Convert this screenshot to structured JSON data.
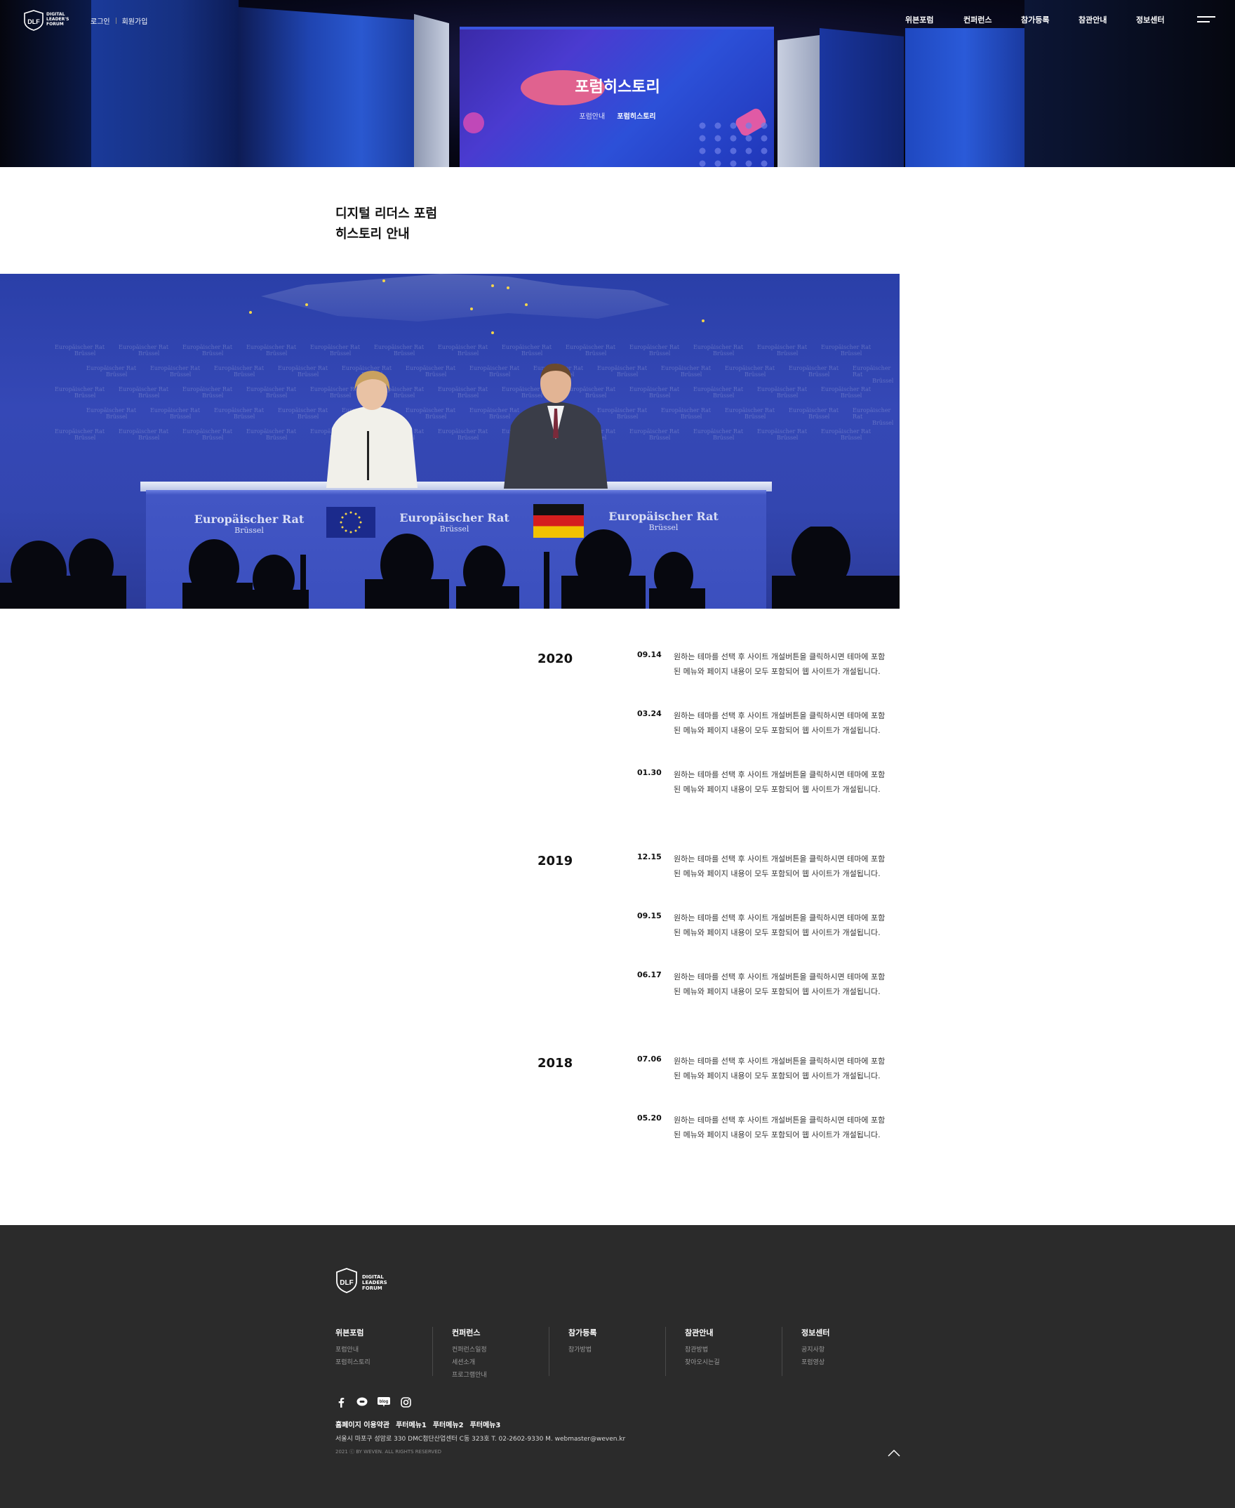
{
  "header": {
    "logo_lines": [
      "DIGITAL",
      "LEADER'S",
      "FORUM"
    ],
    "logo_mark": "DLF",
    "auth": {
      "login": "로그인",
      "signup": "회원가입"
    },
    "nav": [
      "위븐포럼",
      "컨퍼런스",
      "참가등록",
      "참관안내",
      "정보센터"
    ],
    "menu_icon": "hamburger-icon"
  },
  "hero": {
    "title": "포럼히스토리",
    "breadcrumb": [
      "포럼안내",
      "포럼히스토리"
    ]
  },
  "intro": {
    "line1": "디지털 리더스 포럼",
    "line2": "히스토리 안내"
  },
  "photo": {
    "wall_text": [
      "Europäischer Rat",
      "Brüssel"
    ],
    "podium_labels": [
      {
        "l1": "Europäischer Rat",
        "l2": "Brüssel"
      },
      {
        "l1": "Europäischer Rat",
        "l2": "Brüssel"
      },
      {
        "l1": "Europäischer Rat",
        "l2": "Brüssel"
      }
    ]
  },
  "timeline": [
    {
      "year": "2020",
      "entries": [
        {
          "date": "09.14",
          "text": "원하는 테마를 선택 후 사이트 개설버튼을 클릭하시면 테마에 포함된 메뉴와 페이지 내용이 모두 포함되어 웹 사이트가 개설됩니다."
        },
        {
          "date": "03.24",
          "text": "원하는 테마를 선택 후 사이트 개설버튼을 클릭하시면 테마에 포함된 메뉴와 페이지 내용이 모두 포함되어 웹 사이트가 개설됩니다."
        },
        {
          "date": "01.30",
          "text": "원하는 테마를 선택 후 사이트 개설버튼을 클릭하시면 테마에 포함된 메뉴와 페이지 내용이 모두 포함되어 웹 사이트가 개설됩니다."
        }
      ]
    },
    {
      "year": "2019",
      "entries": [
        {
          "date": "12.15",
          "text": "원하는 테마를 선택 후 사이트 개설버튼을 클릭하시면 테마에 포함된 메뉴와 페이지 내용이 모두 포함되어 웹 사이트가 개설됩니다."
        },
        {
          "date": "09.15",
          "text": "원하는 테마를 선택 후 사이트 개설버튼을 클릭하시면 테마에 포함된 메뉴와 페이지 내용이 모두 포함되어 웹 사이트가 개설됩니다."
        },
        {
          "date": "06.17",
          "text": "원하는 테마를 선택 후 사이트 개설버튼을 클릭하시면 테마에 포함된 메뉴와 페이지 내용이 모두 포함되어 웹 사이트가 개설됩니다."
        }
      ]
    },
    {
      "year": "2018",
      "entries": [
        {
          "date": "07.06",
          "text": "원하는 테마를 선택 후 사이트 개설버튼을 클릭하시면 테마에 포함된 메뉴와 페이지 내용이 모두 포함되어 웹 사이트가 개설됩니다."
        },
        {
          "date": "05.20",
          "text": "원하는 테마를 선택 후 사이트 개설버튼을 클릭하시면 테마에 포함된 메뉴와 페이지 내용이 모두 포함되어 웹 사이트가 개설됩니다."
        }
      ]
    }
  ],
  "footer": {
    "logo_lines": [
      "DIGITAL",
      "LEADERS",
      "FORUM"
    ],
    "logo_mark": "DLF",
    "columns": [
      {
        "heading": "위븐포럼",
        "items": [
          "포럼안내",
          "포럼히스토리"
        ]
      },
      {
        "heading": "컨퍼런스",
        "items": [
          "컨퍼런스일정",
          "세션소개",
          "프로그램안내"
        ]
      },
      {
        "heading": "참가등록",
        "items": [
          "참가방법"
        ]
      },
      {
        "heading": "참관안내",
        "items": [
          "참관방법",
          "찾아오시는길"
        ]
      },
      {
        "heading": "정보센터",
        "items": [
          "공지사항",
          "포럼영상"
        ]
      }
    ],
    "social": [
      "facebook-icon",
      "talk-icon",
      "blog-icon",
      "instagram-icon"
    ],
    "blog_label": "blog",
    "links": [
      "홈페이지 이용약관",
      "푸터메뉴1",
      "푸터메뉴2",
      "푸터메뉴3"
    ],
    "address": "서울시 마포구 성암로 330 DMC첨단산업센터 C동 323호   T. 02-2602-9330 M. webmaster@weven.kr",
    "copyright": "2021 ⓒ BY WEVEN. ALL RIGHTS RESERVED"
  },
  "colors": {
    "footer_bg": "#2b2b2b",
    "hero_blue": "#2a58d0",
    "photo_blue": "#3548b6"
  }
}
